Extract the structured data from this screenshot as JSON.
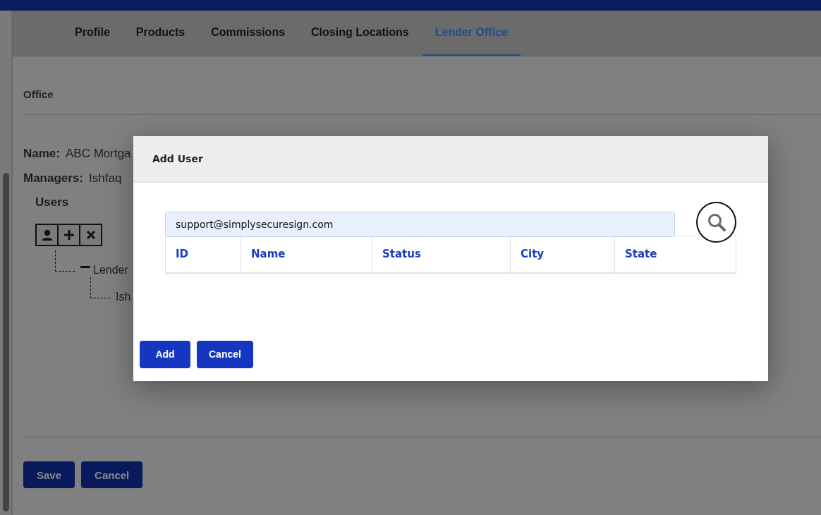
{
  "tabs": [
    {
      "label": "Profile",
      "selected": false
    },
    {
      "label": "Products",
      "selected": false
    },
    {
      "label": "Commissions",
      "selected": false
    },
    {
      "label": "Closing Locations",
      "selected": false
    },
    {
      "label": "Lender Office",
      "selected": true
    }
  ],
  "section_title": "Office",
  "fields": [
    {
      "label": "Name:",
      "value": "ABC Mortga"
    },
    {
      "label": "Managers:",
      "value": "Ishfaq"
    }
  ],
  "users": {
    "title": "Users",
    "tools": [
      {
        "kind": "person"
      },
      {
        "kind": "add"
      },
      {
        "kind": "remove"
      }
    ],
    "tree": [
      {
        "label": "Lender",
        "expanded": true,
        "children": [
          {
            "label": "Ish"
          }
        ]
      }
    ]
  },
  "buttons": [
    "Save",
    "Cancel"
  ],
  "dialog": {
    "title": "Add User",
    "search": {
      "value": "support@simplysecuresign.com"
    },
    "table": {
      "columns": [
        "ID",
        "Name",
        "Status",
        "City",
        "State"
      ]
    },
    "buttons": [
      "Add",
      "Cancel"
    ]
  }
}
